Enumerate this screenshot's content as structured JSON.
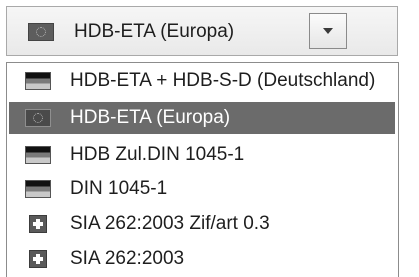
{
  "combo": {
    "selected_label": "HDB-ETA (Europa)",
    "selected_icon": "eu-flag-icon",
    "dropdown_icon": "chevron-down-icon"
  },
  "options": [
    {
      "label": "HDB-ETA + HDB-S-D (Deutschland)",
      "icon": "germany-flag-icon",
      "selected": false
    },
    {
      "label": "HDB-ETA (Europa)",
      "icon": "eu-flag-icon",
      "selected": true
    },
    {
      "label": "HDB Zul.DIN 1045-1",
      "icon": "germany-flag-icon",
      "selected": false
    },
    {
      "label": "DIN 1045-1",
      "icon": "germany-flag-icon",
      "selected": false
    },
    {
      "label": "SIA 262:2003 Zif/art 0.3",
      "icon": "switzerland-flag-icon",
      "selected": false
    },
    {
      "label": "SIA 262:2003",
      "icon": "switzerland-flag-icon",
      "selected": false
    }
  ],
  "colors": {
    "selected_background": "#6b6b6b",
    "selected_text": "#ffffff"
  }
}
